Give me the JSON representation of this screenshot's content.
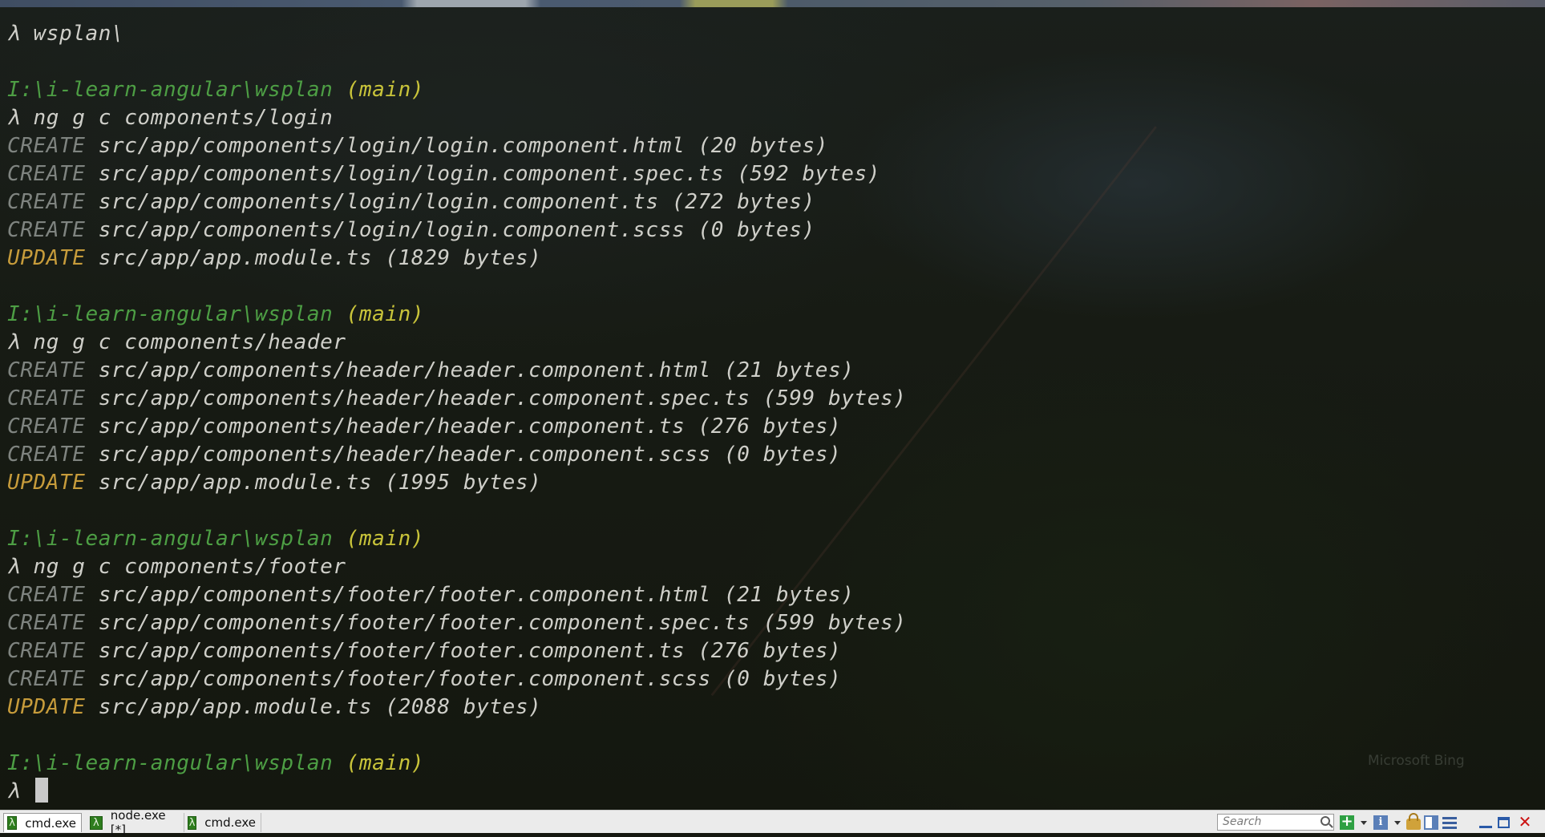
{
  "terminal": {
    "lines": [
      {
        "kind": "cmd",
        "prefix": "λ",
        "text": "wsplan\\"
      },
      {
        "kind": "blank"
      },
      {
        "kind": "prompt",
        "path": "I:\\i-learn-angular\\wsplan",
        "branch": "(main)"
      },
      {
        "kind": "cmd",
        "prefix": "λ",
        "text": "ng g c components/login"
      },
      {
        "kind": "out",
        "tag": "CREATE",
        "text": "src/app/components/login/login.component.html (20 bytes)"
      },
      {
        "kind": "out",
        "tag": "CREATE",
        "text": "src/app/components/login/login.component.spec.ts (592 bytes)"
      },
      {
        "kind": "out",
        "tag": "CREATE",
        "text": "src/app/components/login/login.component.ts (272 bytes)"
      },
      {
        "kind": "out",
        "tag": "CREATE",
        "text": "src/app/components/login/login.component.scss (0 bytes)"
      },
      {
        "kind": "out",
        "tag": "UPDATE",
        "text": "src/app/app.module.ts (1829 bytes)"
      },
      {
        "kind": "blank"
      },
      {
        "kind": "prompt",
        "path": "I:\\i-learn-angular\\wsplan",
        "branch": "(main)"
      },
      {
        "kind": "cmd",
        "prefix": "λ",
        "text": "ng g c components/header"
      },
      {
        "kind": "out",
        "tag": "CREATE",
        "text": "src/app/components/header/header.component.html (21 bytes)"
      },
      {
        "kind": "out",
        "tag": "CREATE",
        "text": "src/app/components/header/header.component.spec.ts (599 bytes)"
      },
      {
        "kind": "out",
        "tag": "CREATE",
        "text": "src/app/components/header/header.component.ts (276 bytes)"
      },
      {
        "kind": "out",
        "tag": "CREATE",
        "text": "src/app/components/header/header.component.scss (0 bytes)"
      },
      {
        "kind": "out",
        "tag": "UPDATE",
        "text": "src/app/app.module.ts (1995 bytes)"
      },
      {
        "kind": "blank"
      },
      {
        "kind": "prompt",
        "path": "I:\\i-learn-angular\\wsplan",
        "branch": "(main)"
      },
      {
        "kind": "cmd",
        "prefix": "λ",
        "text": "ng g c components/footer"
      },
      {
        "kind": "out",
        "tag": "CREATE",
        "text": "src/app/components/footer/footer.component.html (21 bytes)"
      },
      {
        "kind": "out",
        "tag": "CREATE",
        "text": "src/app/components/footer/footer.component.spec.ts (599 bytes)"
      },
      {
        "kind": "out",
        "tag": "CREATE",
        "text": "src/app/components/footer/footer.component.ts (276 bytes)"
      },
      {
        "kind": "out",
        "tag": "CREATE",
        "text": "src/app/components/footer/footer.component.scss (0 bytes)"
      },
      {
        "kind": "out",
        "tag": "UPDATE",
        "text": "src/app/app.module.ts (2088 bytes)"
      },
      {
        "kind": "blank"
      },
      {
        "kind": "prompt",
        "path": "I:\\i-learn-angular\\wsplan",
        "branch": "(main)"
      },
      {
        "kind": "input",
        "prefix": "λ",
        "text": ""
      }
    ],
    "watermark": "Microsoft Bing"
  },
  "tabs": [
    {
      "label": "cmd.exe",
      "icon": "lambda-icon",
      "active": true
    },
    {
      "label": "node.exe [*]",
      "icon": "lambda-icon",
      "active": false
    },
    {
      "label": "cmd.exe",
      "icon": "lambda-icon",
      "active": false
    }
  ],
  "toolbar": {
    "search_placeholder": "Search",
    "lambda_glyph": "λ",
    "add_glyph": "+",
    "info_glyph": "i",
    "close_glyph": "✕"
  },
  "colors": {
    "prompt_path": "#4d9e44",
    "branch": "#c9c43a",
    "create_tag": "#7f8480",
    "update_tag": "#c79c3b",
    "text": "#cfcfc9"
  }
}
